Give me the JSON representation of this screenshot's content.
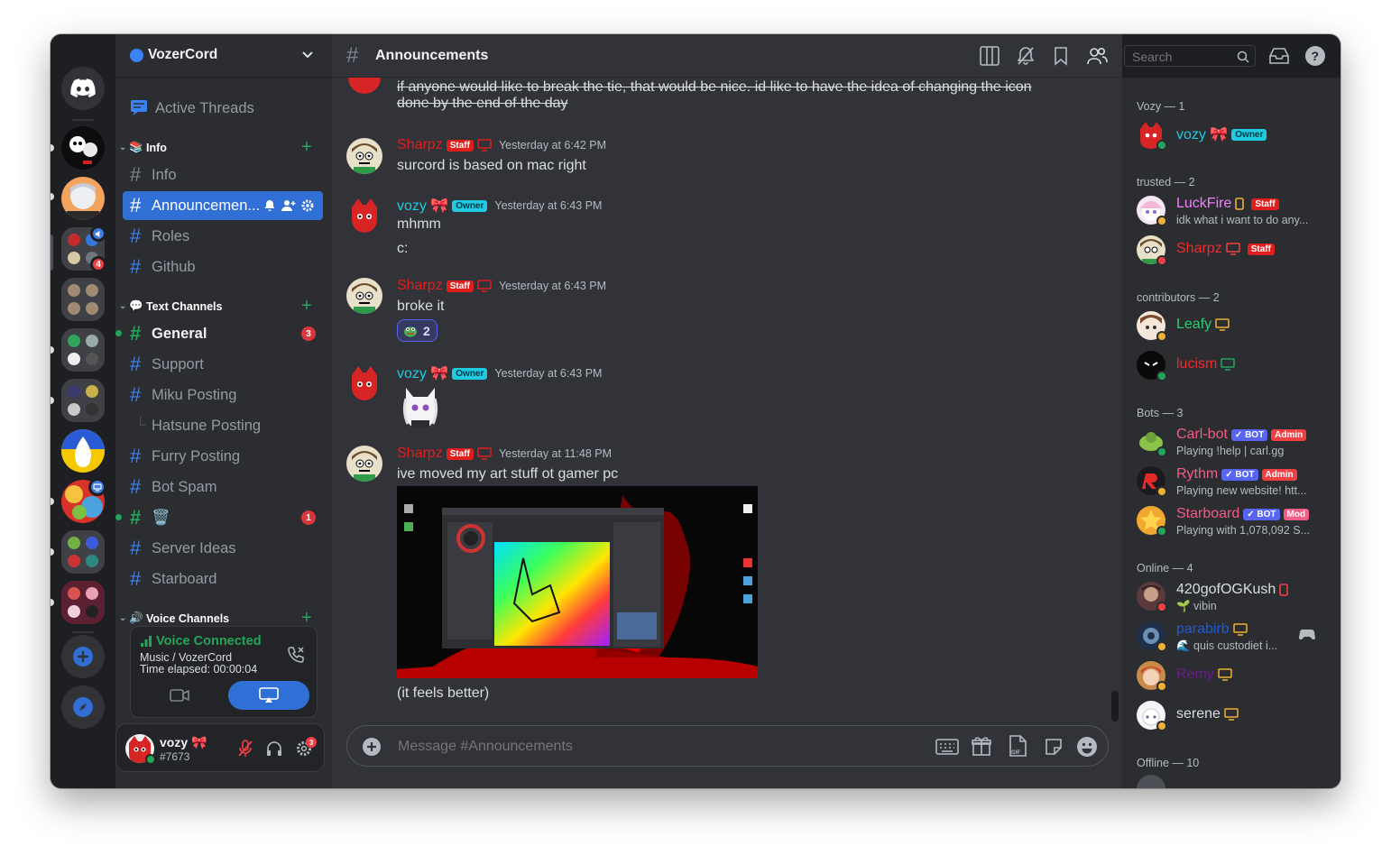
{
  "server": {
    "name": "VozerCord"
  },
  "rail": {
    "mention_badge": "4"
  },
  "sidebar": {
    "active_threads": "Active Threads",
    "categories": [
      {
        "name": "Info",
        "channels": [
          "Info",
          "Announcemen...",
          "Roles",
          "Github"
        ]
      },
      {
        "name": "Text Channels",
        "channels": [
          "General",
          "Support",
          "Miku Posting",
          "Hatsune Posting",
          "Furry Posting",
          "Bot Spam",
          "🗑️",
          "Server Ideas",
          "Starboard"
        ]
      },
      {
        "name": "Voice Channels"
      }
    ],
    "general_badge": "3",
    "trash_badge": "1"
  },
  "voice": {
    "status": "Voice Connected",
    "channel": "Music / VozerCord",
    "elapsed": "Time elapsed: 00:00:04"
  },
  "user_panel": {
    "name": "vozy 🎀",
    "tag": "#7673",
    "settings_badge": "3"
  },
  "chat": {
    "channel_name": "Announcements",
    "search_placeholder": "Search",
    "composer_placeholder": "Message #Announcements",
    "top_strike_1": "if anyone would like to break the tie, that would be nice. id like to have the idea of changing the icon",
    "top_strike_2": "done by the end of the day",
    "messages": [
      {
        "author": "Sharpz",
        "badge": "Staff",
        "time": "Yesterday at 6:42 PM",
        "lines": [
          "surcord is based on mac right"
        ]
      },
      {
        "author": "vozy 🎀",
        "badge": "Owner",
        "time": "Yesterday at 6:43 PM",
        "lines": [
          "mhmm",
          "c:"
        ]
      },
      {
        "author": "Sharpz",
        "badge": "Staff",
        "time": "Yesterday at 6:43 PM",
        "lines": [
          "broke it"
        ],
        "reaction_count": "2"
      },
      {
        "author": "vozy 🎀",
        "badge": "Owner",
        "time": "Yesterday at 6:43 PM",
        "lines": []
      },
      {
        "author": "Sharpz",
        "badge": "Staff",
        "time": "Yesterday at 11:48 PM",
        "lines": [
          "ive moved my art stuff ot gamer pc",
          "(it feels better)"
        ]
      }
    ]
  },
  "members": {
    "groups": [
      {
        "title": "Vozy — 1",
        "members": [
          {
            "name": "vozy 🎀",
            "badge": "Owner",
            "color": "#1ecbe1"
          }
        ]
      },
      {
        "title": "trusted — 2",
        "members": [
          {
            "name": "LuckFire",
            "badge": "Staff",
            "sub": "idk what i want to do any...",
            "color": "#f47fff"
          },
          {
            "name": "Sharpz",
            "badge": "Staff",
            "color": "#ed2b2b"
          }
        ]
      },
      {
        "title": "contributors — 2",
        "members": [
          {
            "name": "Leafy",
            "color": "#2ecc71"
          },
          {
            "name": "lucism",
            "color": "#ed2b2b"
          }
        ]
      },
      {
        "title": "Bots — 3",
        "members": [
          {
            "name": "Carl-bot",
            "bot": "✓ BOT",
            "badge": "Admin",
            "sub": "Playing !help | carl.gg",
            "color": "#f25d86"
          },
          {
            "name": "Rythm",
            "bot": "✓ BOT",
            "badge": "Admin",
            "sub": "Playing new website! htt...",
            "color": "#f25d86"
          },
          {
            "name": "Starboard",
            "bot": "✓ BOT",
            "badge": "Mod",
            "sub": "Playing with 1,078,092 S...",
            "color": "#f25d86"
          }
        ]
      },
      {
        "title": "Online — 4",
        "members": [
          {
            "name": "420gofOGKush",
            "sub": "vibin",
            "color": "#dbdee1"
          },
          {
            "name": "parabirb",
            "sub": "quis custodiet i...",
            "color": "#1f59d6"
          },
          {
            "name": "Remy",
            "color": "#6a1b8a"
          },
          {
            "name": "serene",
            "color": "#dbdee1"
          }
        ]
      },
      {
        "title": "Offline — 10",
        "members": []
      }
    ]
  },
  "colors": {
    "accent": "#2f6fd6",
    "staff": "#e01e1e",
    "owner": "#1ecbe1",
    "online": "#23a55a",
    "idle": "#f0b232",
    "dnd": "#f23f43"
  }
}
